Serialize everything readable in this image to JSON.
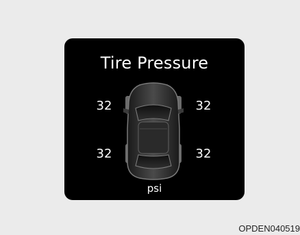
{
  "display": {
    "title": "Tire Pressure",
    "front_left": "32",
    "front_right": "32",
    "rear_left": "32",
    "rear_right": "32",
    "unit": "psi"
  },
  "caption": "OPDEN040519",
  "colors": {
    "background": "#ebebeb",
    "display_bg": "#000000",
    "text": "#ffffff"
  }
}
